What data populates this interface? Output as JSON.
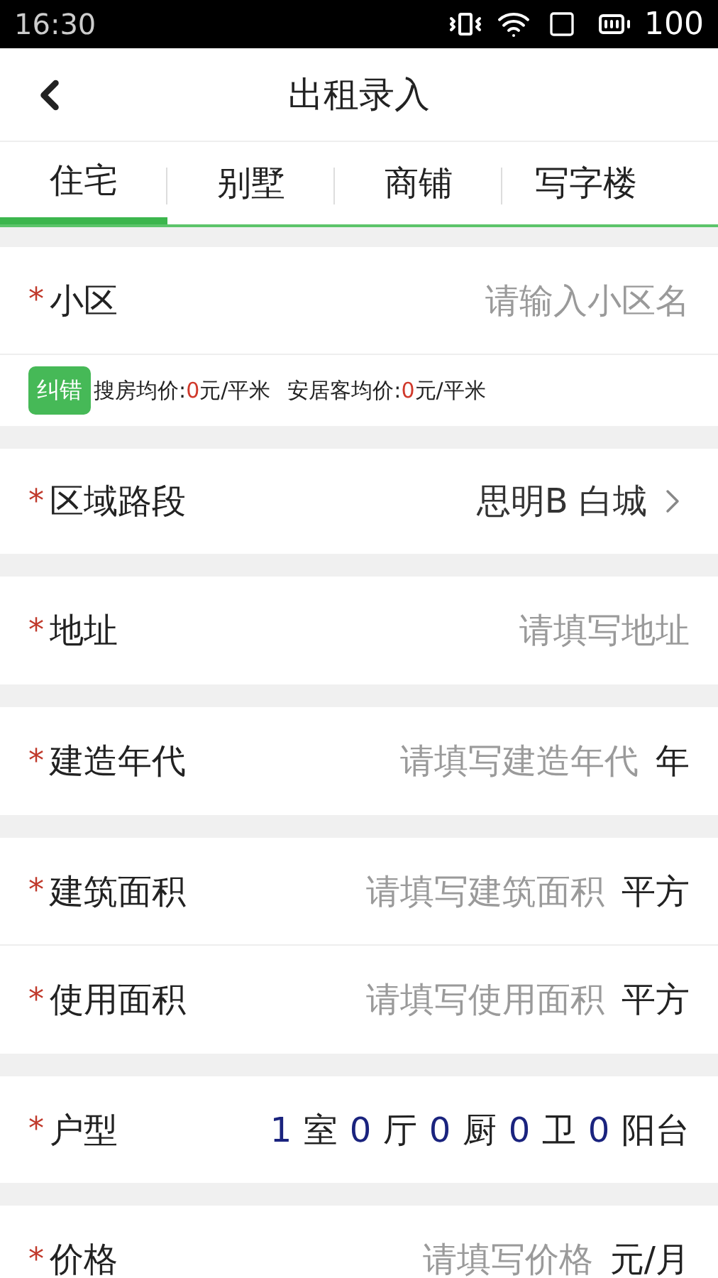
{
  "status_bar": {
    "time": "16:30",
    "battery": "100"
  },
  "header": {
    "title": "出租录入"
  },
  "tabs": [
    {
      "label": "住宅",
      "selected": true
    },
    {
      "label": "别墅",
      "selected": false
    },
    {
      "label": "商铺",
      "selected": false
    },
    {
      "label": "写字楼",
      "selected": false
    }
  ],
  "sections": [
    {
      "rows": [
        {
          "kind": "input",
          "label": "小区",
          "mark": "*",
          "placeholder": "请输入小区名"
        },
        {
          "kind": "info",
          "button": "纠错",
          "parts": [
            {
              "label": "搜房均价:",
              "value": "0",
              "unit": "元/平米"
            },
            {
              "label": "安居客均价:",
              "value": "0",
              "unit": "元/平米"
            }
          ]
        }
      ]
    },
    {
      "rows": [
        {
          "kind": "select",
          "label": "区域路段",
          "mark": "*",
          "value": "思明B 白城"
        }
      ]
    },
    {
      "rows": [
        {
          "kind": "input",
          "label": "地址",
          "mark": "*",
          "placeholder": "请填写地址"
        }
      ]
    },
    {
      "rows": [
        {
          "kind": "input",
          "label": "建造年代",
          "mark": "*",
          "placeholder": "请填写建造年代",
          "unit": "年"
        }
      ]
    },
    {
      "rows": [
        {
          "kind": "input",
          "label": "建筑面积",
          "mark": "*",
          "placeholder": "请填写建筑面积",
          "unit": "平方"
        },
        {
          "kind": "input",
          "label": "使用面积",
          "mark": "*",
          "placeholder": "请填写使用面积",
          "unit": "平方"
        }
      ]
    },
    {
      "rows": [
        {
          "kind": "layout",
          "label": "户型",
          "mark": "*",
          "fields": [
            {
              "value": "1",
              "unit": "室"
            },
            {
              "value": "0",
              "unit": "厅"
            },
            {
              "value": "0",
              "unit": "厨"
            },
            {
              "value": "0",
              "unit": "卫"
            },
            {
              "value": "0",
              "unit": "阳台"
            }
          ]
        }
      ]
    },
    {
      "rows": [
        {
          "kind": "input",
          "label": "价格",
          "mark": "*",
          "placeholder": "请填写价格",
          "unit": "元/月"
        }
      ]
    }
  ]
}
